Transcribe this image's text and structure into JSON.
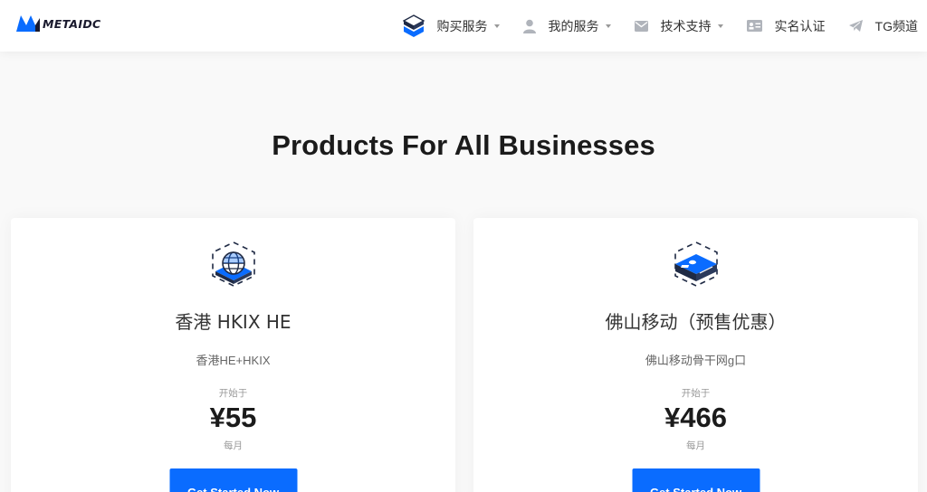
{
  "brand": {
    "logo_text": "METAIDC",
    "accent": "#0a6cff"
  },
  "nav": {
    "items": [
      {
        "label": "购买服务",
        "icon": "cube-stack-icon",
        "dropdown": true
      },
      {
        "label": "我的服务",
        "icon": "user-icon",
        "dropdown": true
      },
      {
        "label": "技术支持",
        "icon": "mail-icon",
        "dropdown": true
      },
      {
        "label": "实名认证",
        "icon": "id-card-icon",
        "dropdown": false
      },
      {
        "label": "TG频道",
        "icon": "telegram-icon",
        "dropdown": false
      }
    ]
  },
  "main": {
    "title": "Products For All Businesses"
  },
  "products": [
    {
      "icon": "globe-network-icon",
      "name": "香港 HKIX HE",
      "desc": "香港HE+HKIX",
      "from_label": "开始于",
      "price": "¥55",
      "unit": "每月",
      "button": "Get Started Now"
    },
    {
      "icon": "server-icon",
      "name": "佛山移动（预售优惠）",
      "desc": "佛山移动骨干网g口",
      "from_label": "开始于",
      "price": "¥466",
      "unit": "每月",
      "button": "Get Started Now"
    }
  ]
}
